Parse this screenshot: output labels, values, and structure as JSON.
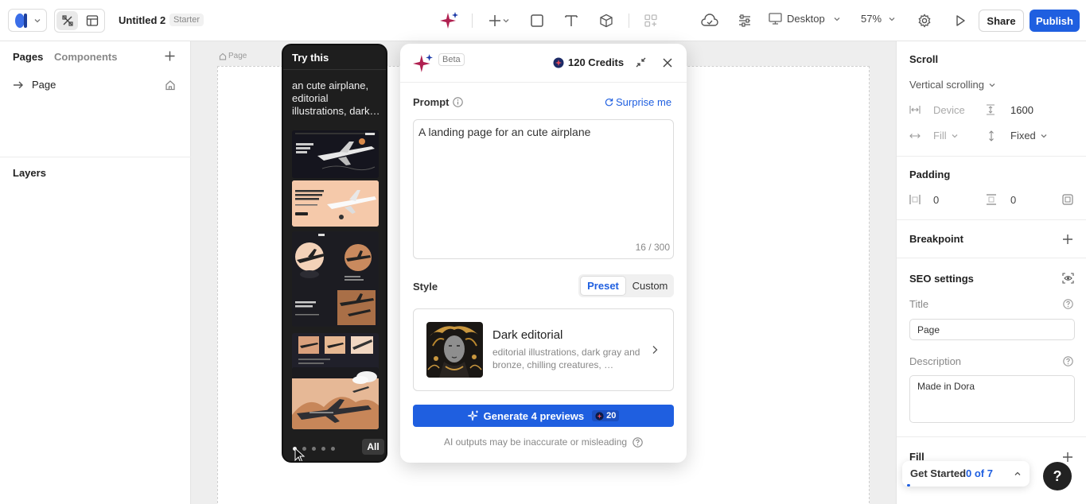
{
  "topbar": {
    "project_name": "Untitled 2",
    "plan_badge": "Starter",
    "device_label": "Desktop",
    "zoom": "57%",
    "share_label": "Share",
    "publish_label": "Publish"
  },
  "left_panel": {
    "tabs": [
      "Pages",
      "Components"
    ],
    "pages": [
      {
        "label": "Page"
      }
    ],
    "layers_title": "Layers"
  },
  "canvas": {
    "frame_label": "Page"
  },
  "try_panel": {
    "title": "Try this",
    "prompt_preview": "an cute airplane, editorial illustrations, dark…",
    "all_label": "All"
  },
  "modal": {
    "beta_badge": "Beta",
    "credits_label": "120 Credits",
    "prompt_label": "Prompt",
    "surprise_label": "Surprise me",
    "prompt_value": "A landing page for an cute airplane",
    "char_count": "16 / 300",
    "style_label": "Style",
    "style_tabs": [
      "Preset",
      "Custom"
    ],
    "style_card": {
      "title": "Dark editorial",
      "description": "editorial illustrations, dark gray and bronze, chilling creatures, …"
    },
    "generate_label": "Generate 4 previews",
    "generate_cost": "20",
    "disclaimer": "AI outputs may be inaccurate or misleading"
  },
  "right_panel": {
    "scroll_title": "Scroll",
    "scroll_mode": "Vertical scrolling",
    "device_label": "Device",
    "height_value": "1600",
    "fill_label": "Fill",
    "fixed_label": "Fixed",
    "padding_title": "Padding",
    "padding_x": "0",
    "padding_y": "0",
    "breakpoint_title": "Breakpoint",
    "seo_title": "SEO settings",
    "title_label": "Title",
    "title_value": "Page",
    "description_label": "Description",
    "description_value": "Made in Dora",
    "fill_title": "Fill"
  },
  "get_started": {
    "label": "Get Started",
    "progress": "0 of 7"
  },
  "help_label": "?",
  "colors": {
    "accent": "#1f5fe0",
    "dark_panel": "#1e1e1e",
    "text": "#1f2328"
  }
}
